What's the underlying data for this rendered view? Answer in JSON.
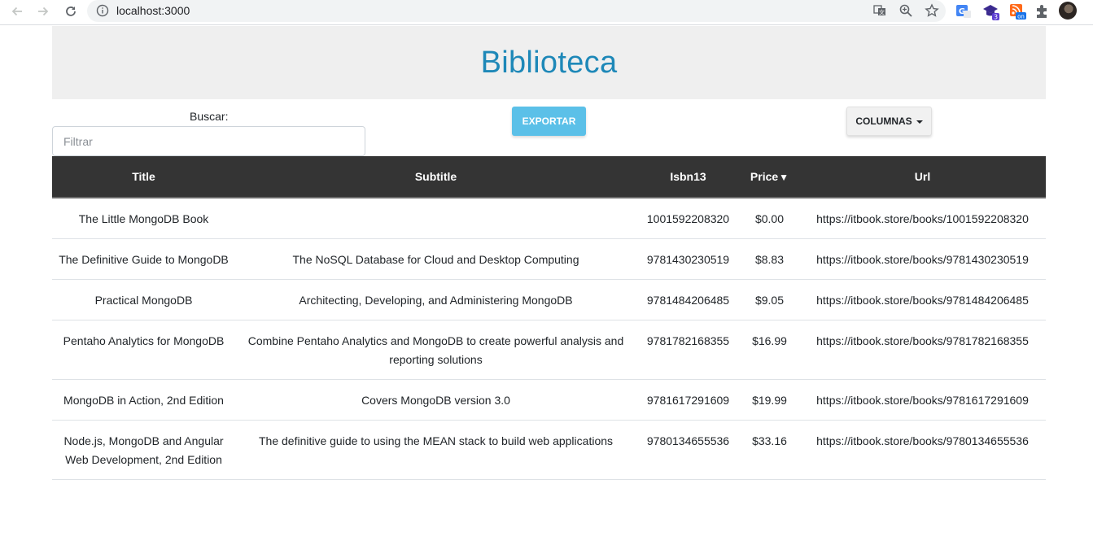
{
  "browser": {
    "url": "localhost:3000"
  },
  "header": {
    "title": "Biblioteca"
  },
  "controls": {
    "search_label": "Buscar:",
    "search_placeholder": "Filtrar",
    "search_value": "",
    "export_label": "EXPORTAR",
    "columns_label": "COLUMNAS"
  },
  "table": {
    "columns": [
      "Title",
      "Subtitle",
      "Isbn13",
      "Price",
      "Url"
    ],
    "sort_indicator": "▼",
    "rows": [
      [
        "The Little MongoDB Book",
        "",
        "1001592208320",
        "$0.00",
        "https://itbook.store/books/1001592208320"
      ],
      [
        "The Definitive Guide to MongoDB",
        "The NoSQL Database for Cloud and Desktop Computing",
        "9781430230519",
        "$8.83",
        "https://itbook.store/books/9781430230519"
      ],
      [
        "Practical MongoDB",
        "Architecting, Developing, and Administering MongoDB",
        "9781484206485",
        "$9.05",
        "https://itbook.store/books/9781484206485"
      ],
      [
        "Pentaho Analytics for MongoDB",
        "Combine Pentaho Analytics and MongoDB to create powerful analysis and reporting solutions",
        "9781782168355",
        "$16.99",
        "https://itbook.store/books/9781782168355"
      ],
      [
        "MongoDB in Action, 2nd Edition",
        "Covers MongoDB version 3.0",
        "9781617291609",
        "$19.99",
        "https://itbook.store/books/9781617291609"
      ],
      [
        "Node.js, MongoDB and Angular Web Development, 2nd Edition",
        "The definitive guide to using the MEAN stack to build web applications",
        "9780134655536",
        "$33.16",
        "https://itbook.store/books/9780134655536"
      ]
    ]
  },
  "colors": {
    "title": "#1e88b8",
    "export_button": "#5bc0e8",
    "table_header": "#343434"
  }
}
